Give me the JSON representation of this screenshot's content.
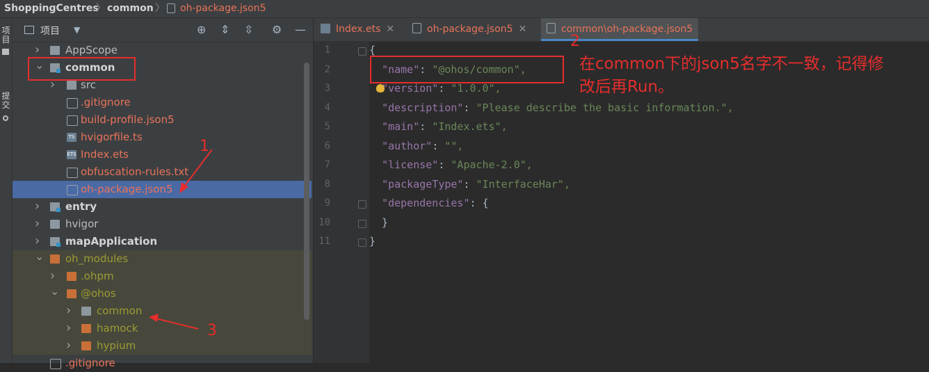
{
  "breadcrumb": {
    "project": "ShoppingCentres",
    "module": "common",
    "file": "oh-package.json5"
  },
  "strip": {
    "top": "项目",
    "bottom": "提交"
  },
  "panel": {
    "title": "项目"
  },
  "tree": [
    {
      "label": "AppScope",
      "type": "folder"
    },
    {
      "label": "common",
      "type": "module"
    },
    {
      "label": "src",
      "type": "folder"
    },
    {
      "label": ".gitignore",
      "type": "file"
    },
    {
      "label": "build-profile.json5",
      "type": "file"
    },
    {
      "label": "hvigorfile.ts",
      "type": "ts"
    },
    {
      "label": "Index.ets",
      "type": "ets"
    },
    {
      "label": "obfuscation-rules.txt",
      "type": "file"
    },
    {
      "label": "oh-package.json5",
      "type": "file"
    },
    {
      "label": "entry",
      "type": "module"
    },
    {
      "label": "hvigor",
      "type": "folder"
    },
    {
      "label": "mapApplication",
      "type": "module"
    },
    {
      "label": "oh_modules",
      "type": "folder-orange"
    },
    {
      "label": ".ohpm",
      "type": "folder-orange"
    },
    {
      "label": "@ohos",
      "type": "folder-orange"
    },
    {
      "label": "common",
      "type": "link"
    },
    {
      "label": "hamock",
      "type": "link"
    },
    {
      "label": "hypium",
      "type": "link"
    },
    {
      "label": ".gitignore",
      "type": "file"
    }
  ],
  "tabs": [
    {
      "label": "Index.ets",
      "active": false
    },
    {
      "label": "oh-package.json5",
      "active": false
    },
    {
      "label": "common\\oh-package.json5",
      "active": true
    }
  ],
  "lines": [
    {
      "n": "1",
      "text": "{"
    },
    {
      "n": "2",
      "key": "\"name\"",
      "val": "\"@ohos/common\","
    },
    {
      "n": "3",
      "key": "\"version\"",
      "val": "\"1.0.0\","
    },
    {
      "n": "4",
      "key": "\"description\"",
      "val": "\"Please describe the basic information.\","
    },
    {
      "n": "5",
      "key": "\"main\"",
      "val": "\"Index.ets\","
    },
    {
      "n": "6",
      "key": "\"author\"",
      "val": "\"\","
    },
    {
      "n": "7",
      "key": "\"license\"",
      "val": "\"Apache-2.0\","
    },
    {
      "n": "8",
      "key": "\"packageType\"",
      "val": "\"InterfaceHar\","
    },
    {
      "n": "9",
      "key": "\"dependencies\"",
      "val": "{"
    },
    {
      "n": "10",
      "text": "  }"
    },
    {
      "n": "11",
      "text": "}"
    }
  ],
  "annotations": {
    "n1": "1",
    "n2": "2",
    "n3": "3",
    "note_line1": "在common下的json5名字不一致，记得修",
    "note_line2": "改后再Run。"
  }
}
